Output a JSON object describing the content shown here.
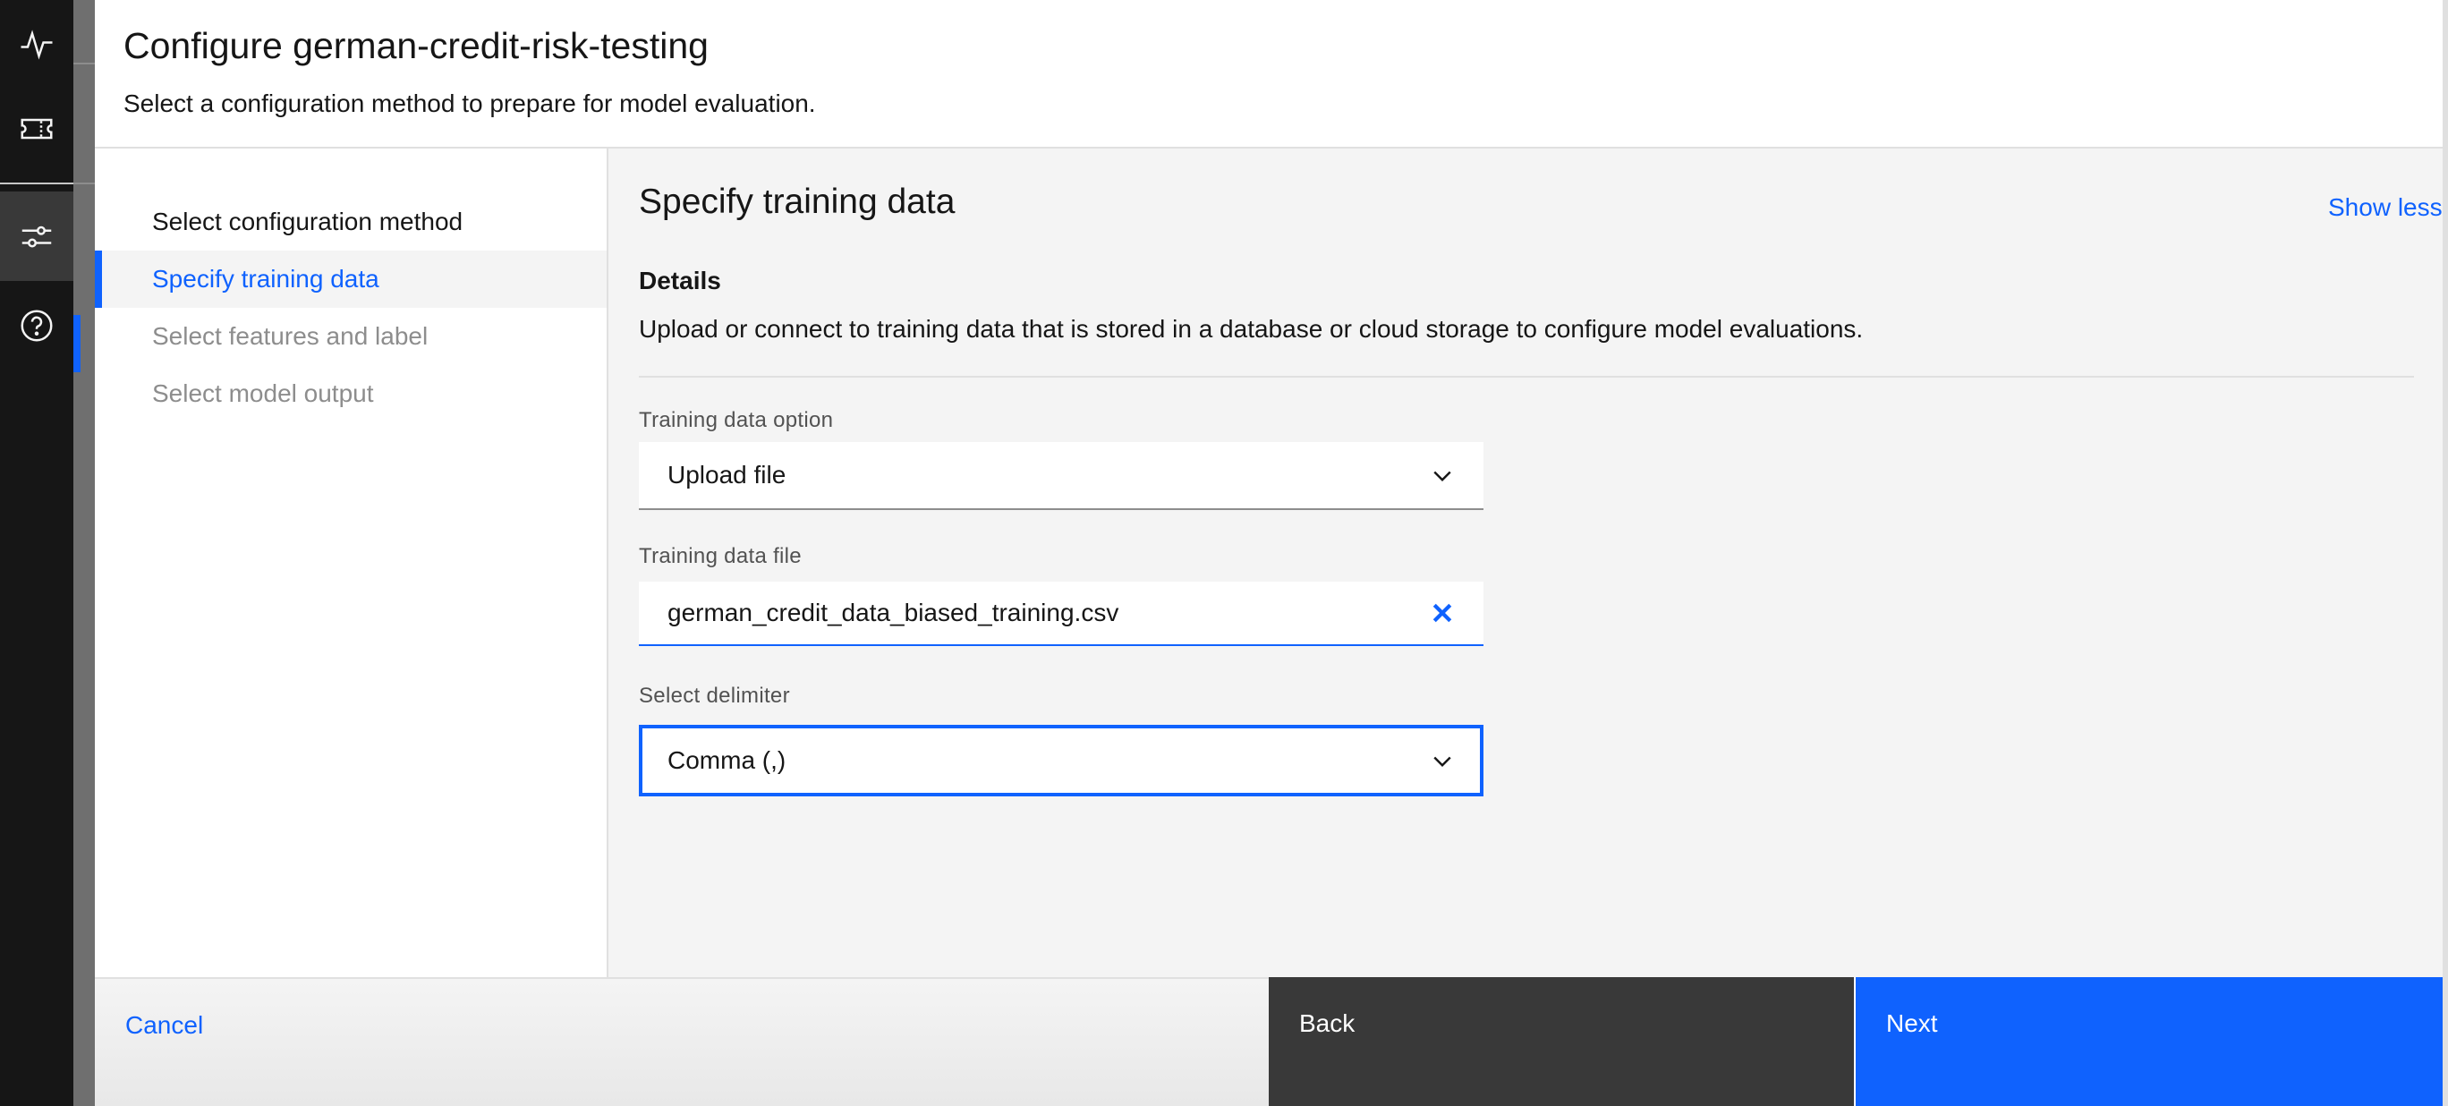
{
  "rail": {
    "items": [
      {
        "icon": "activity-icon"
      },
      {
        "icon": "ticket-icon"
      },
      {
        "icon": "sliders-icon",
        "active": true
      },
      {
        "icon": "help-icon"
      }
    ]
  },
  "modal": {
    "title": "Configure german-credit-risk-testing",
    "subtitle": "Select a configuration method to prepare for model evaluation."
  },
  "steps": [
    {
      "label": "Select configuration method",
      "state": "done"
    },
    {
      "label": "Specify training data",
      "state": "current"
    },
    {
      "label": "Select features and label",
      "state": "pending"
    },
    {
      "label": "Select model output",
      "state": "pending"
    }
  ],
  "content": {
    "section_title": "Specify training data",
    "show_less_label": "Show less",
    "details_heading": "Details",
    "details_text": "Upload or connect to training data that is stored in a database or cloud storage to configure model evaluations.",
    "training_option": {
      "label": "Training data option",
      "value": "Upload file"
    },
    "training_file": {
      "label": "Training data file",
      "value": "german_credit_data_biased_training.csv"
    },
    "delimiter": {
      "label": "Select delimiter",
      "value": "Comma (,)"
    }
  },
  "footer": {
    "cancel_label": "Cancel",
    "back_label": "Back",
    "next_label": "Next"
  },
  "colors": {
    "accent": "#0f62fe",
    "rail_bg": "#161616",
    "back_button": "#393939"
  }
}
